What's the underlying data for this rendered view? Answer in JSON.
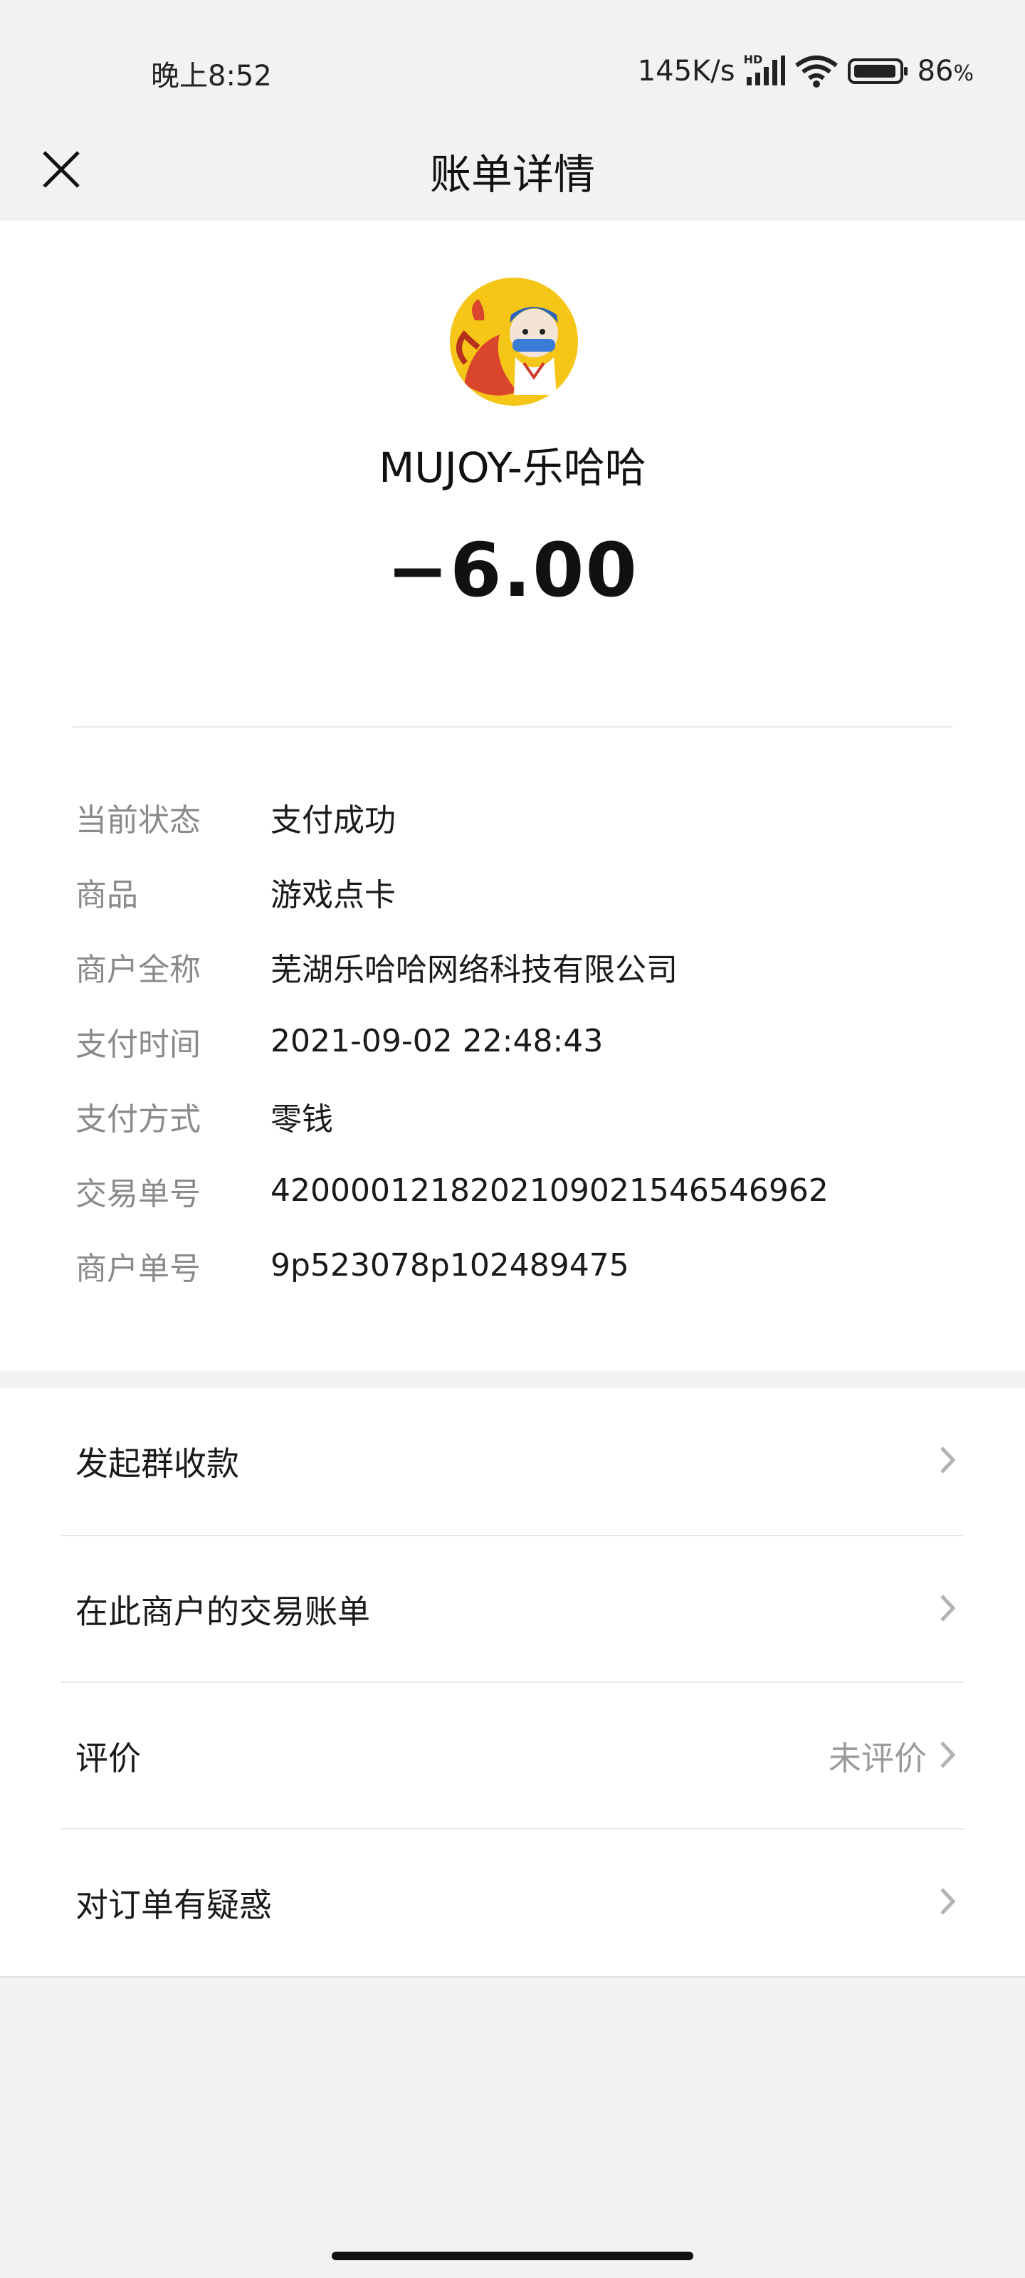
{
  "status_bar": {
    "time": "晚上8:52",
    "network_speed": "145K/s",
    "network_type": "HD",
    "battery": "86",
    "battery_unit": "%",
    "icons": [
      "signal-icon",
      "wifi-icon",
      "battery-icon"
    ]
  },
  "header": {
    "title": "账单详情",
    "close_icon": "close-icon"
  },
  "merchant": {
    "name": "MUJOY-乐哈哈",
    "amount": "−6.00",
    "avatar_icon": "merchant-avatar-icon"
  },
  "details": [
    {
      "label": "当前状态",
      "value": "支付成功"
    },
    {
      "label": "商品",
      "value": "游戏点卡"
    },
    {
      "label": "商户全称",
      "value": "芜湖乐哈哈网络科技有限公司"
    },
    {
      "label": "支付时间",
      "value": "2021-09-02 22:48:43"
    },
    {
      "label": "支付方式",
      "value": "零钱"
    },
    {
      "label": "交易单号",
      "value": "4200001218202109021546546962"
    },
    {
      "label": "商户单号",
      "value": "9p523078p102489475"
    }
  ],
  "menu": [
    {
      "label": "发起群收款",
      "extra": ""
    },
    {
      "label": "在此商户的交易账单",
      "extra": ""
    },
    {
      "label": "评价",
      "extra": "未评价"
    },
    {
      "label": "对订单有疑惑",
      "extra": ""
    }
  ],
  "colors": {
    "background": "#f2f2f2",
    "card": "#ffffff",
    "label_gray": "#8a8a8a",
    "text": "#1a1a1a",
    "avatar_yellow": "#f5c518"
  }
}
